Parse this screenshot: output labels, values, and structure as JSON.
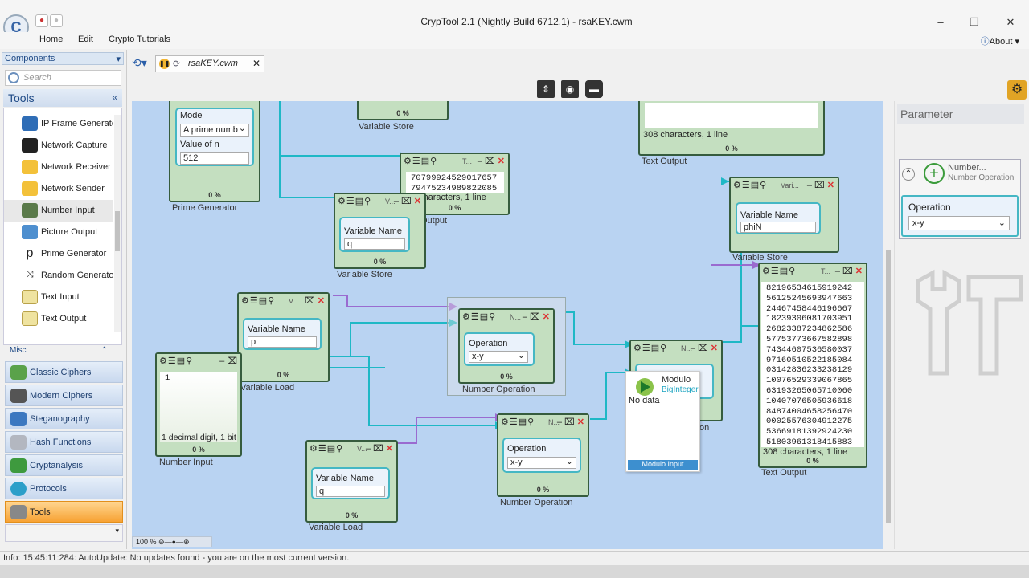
{
  "window": {
    "title": "CrypTool 2.1 (Nightly Build 6712.1) - rsaKEY.cwm",
    "app_icon": "cryptool-logo-icon"
  },
  "menu": {
    "home": "Home",
    "edit": "Edit",
    "tutorials": "Crypto Tutorials",
    "about": "About"
  },
  "components": {
    "header": "Components",
    "search_placeholder": "Search",
    "tools_header": "Tools",
    "tools": [
      "IP Frame Generator",
      "Network Capture",
      "Network Receiver",
      "Network Sender",
      "Number Input",
      "Picture Output",
      "Prime Generator",
      "Random Generator",
      "Text Input",
      "Text Output"
    ],
    "misc": "Misc",
    "categories": [
      "Classic Ciphers",
      "Modern Ciphers",
      "Steganography",
      "Hash Functions",
      "Cryptanalysis",
      "Protocols",
      "Tools"
    ]
  },
  "tab": {
    "label": "rsaKEY.cwm"
  },
  "canvas": {
    "zoom": "100 %",
    "prime_generator": {
      "mode_label": "Mode",
      "mode_value": "A prime numb",
      "n_label": "Value of n",
      "n_value": "512",
      "progress": "0 %",
      "caption": "Prime Generator"
    },
    "vstore_top": {
      "progress": "0 %",
      "caption": "Variable Store"
    },
    "text_out_top": {
      "info": "308 characters,  1 line",
      "progress": "0 %",
      "caption": "Text Output"
    },
    "text_out_mid": {
      "title": "T...",
      "lines": [
        "70799924529017657",
        "79475234989822085"
      ],
      "info": "characters, 1 line",
      "progress": "0 %",
      "caption": "Output"
    },
    "vstore_q": {
      "title": "V...",
      "label": "Variable Name",
      "value": "q",
      "progress": "0 %",
      "caption": "Variable Store"
    },
    "vstore_phin": {
      "title": "Vari...",
      "label": "Variable Name",
      "value": "phiN",
      "progress": "0 %",
      "caption": "Variable Store"
    },
    "vload_p": {
      "title": "V...",
      "label": "Variable Name",
      "value": "p",
      "progress": "0 %",
      "caption": "Variable Load"
    },
    "numop_1": {
      "title": "N...",
      "label": "Operation",
      "value": "x-y",
      "progress": "0 %",
      "caption": "Number Operation"
    },
    "numop_2": {
      "title": "N...",
      "label": "Operation",
      "value": "x-y",
      "progress": "0 %",
      "caption": "Number Operation"
    },
    "numop_3": {
      "title": "N...",
      "caption_tail": "on"
    },
    "number_input": {
      "value": "1",
      "info": "1 decimal digit, 1 bit",
      "progress": "0 %",
      "caption": "Number Input"
    },
    "vload_q": {
      "title": "V...",
      "label": "Variable Name",
      "value": "q",
      "progress": "0 %",
      "caption": "Variable Load"
    },
    "tooltip": {
      "title": "Modulo",
      "type": "BigInteger",
      "status": "No data",
      "footer": "Modulo Input"
    },
    "text_out_big": {
      "title": "T...",
      "lines": [
        "82196534615919242",
        "56125245693947663",
        "24467458446196667",
        "18239306081703951",
        "26823387234862586",
        "57753773667582898",
        "74344607536580037",
        "97160510522185084",
        "03142836233238129",
        "10076529339067865",
        "63193265065710060",
        "10407076505936618",
        "84874004658256470",
        "00025576304912275",
        "53669181392924230",
        "51803961318415883"
      ],
      "info": "308 characters,  1 line",
      "progress": "0 %",
      "caption": "Text Output"
    }
  },
  "parameter": {
    "header": "Parameter",
    "name": "Number...",
    "subname": "Number Operation",
    "op_label": "Operation",
    "op_value": "x-y"
  },
  "status": {
    "text": "Info: 15:45:11:284: AutoUpdate: No updates found - you are on the most current version."
  },
  "colors": {
    "accent": "#f7a233",
    "plugin_bg": "#c4dfc0",
    "canvas_bg": "#b9d3f2",
    "connector_teal": "#1fb8c6",
    "connector_purple": "#9a6bd0"
  }
}
